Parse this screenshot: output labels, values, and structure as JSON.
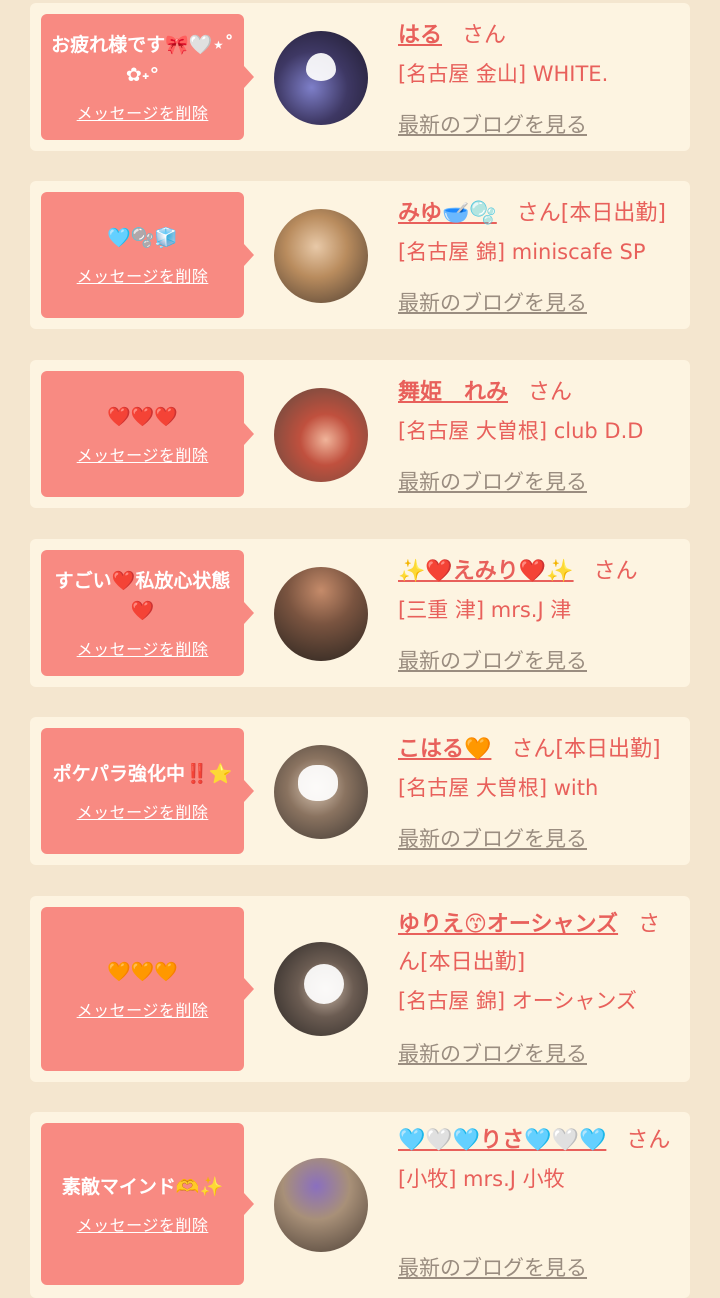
{
  "delete_label": "メッセージを削除",
  "blog_label": "最新のブログを見る",
  "colors": {
    "page_bg": "#f4e6cf",
    "card_bg": "#fdf4e1",
    "bubble": "#f88a82",
    "accent_text": "#e8605b",
    "link_gray": "#9a8d80"
  },
  "entries": [
    {
      "message": "お疲れ様です🎀🤍⋆˚✿˖°",
      "name": "はる",
      "suffix": "さん",
      "location": "[名古屋 金山] WHITE.",
      "avatar": "avatar-photo"
    },
    {
      "message": "🩵🫧🧊",
      "name": "みゆ🥣🫧",
      "suffix": "さん[本日出勤]",
      "location": "[名古屋 錦] miniscafe SP",
      "avatar": "avatar-photo"
    },
    {
      "message": "❤️❤️❤️",
      "name": "舞姫　れみ",
      "suffix": "さん",
      "location": "[名古屋 大曽根] club D.D",
      "avatar": "avatar-photo"
    },
    {
      "message": "すごい❤️私放心状態❤️",
      "name": "✨❤️えみり❤️✨",
      "suffix": "さん",
      "location": "[三重 津] mrs.J 津",
      "avatar": "avatar-photo"
    },
    {
      "message": "ポケパラ強化中‼️⭐️",
      "name": "こはる🧡",
      "suffix": "さん[本日出勤]",
      "location": "[名古屋 大曽根] with",
      "avatar": "avatar-photo"
    },
    {
      "message": "🧡🧡🧡",
      "name": "ゆりえ😙オーシャンズ",
      "suffix": "さん[本日出勤]",
      "location": "[名古屋 錦] オーシャンズ",
      "avatar": "avatar-photo"
    },
    {
      "message": "素敵マインド🫶✨",
      "name": "🩵🤍🩵りさ🩵🤍🩵",
      "suffix": "さん",
      "location": "[小牧] mrs.J 小牧",
      "avatar": "avatar-photo"
    }
  ]
}
